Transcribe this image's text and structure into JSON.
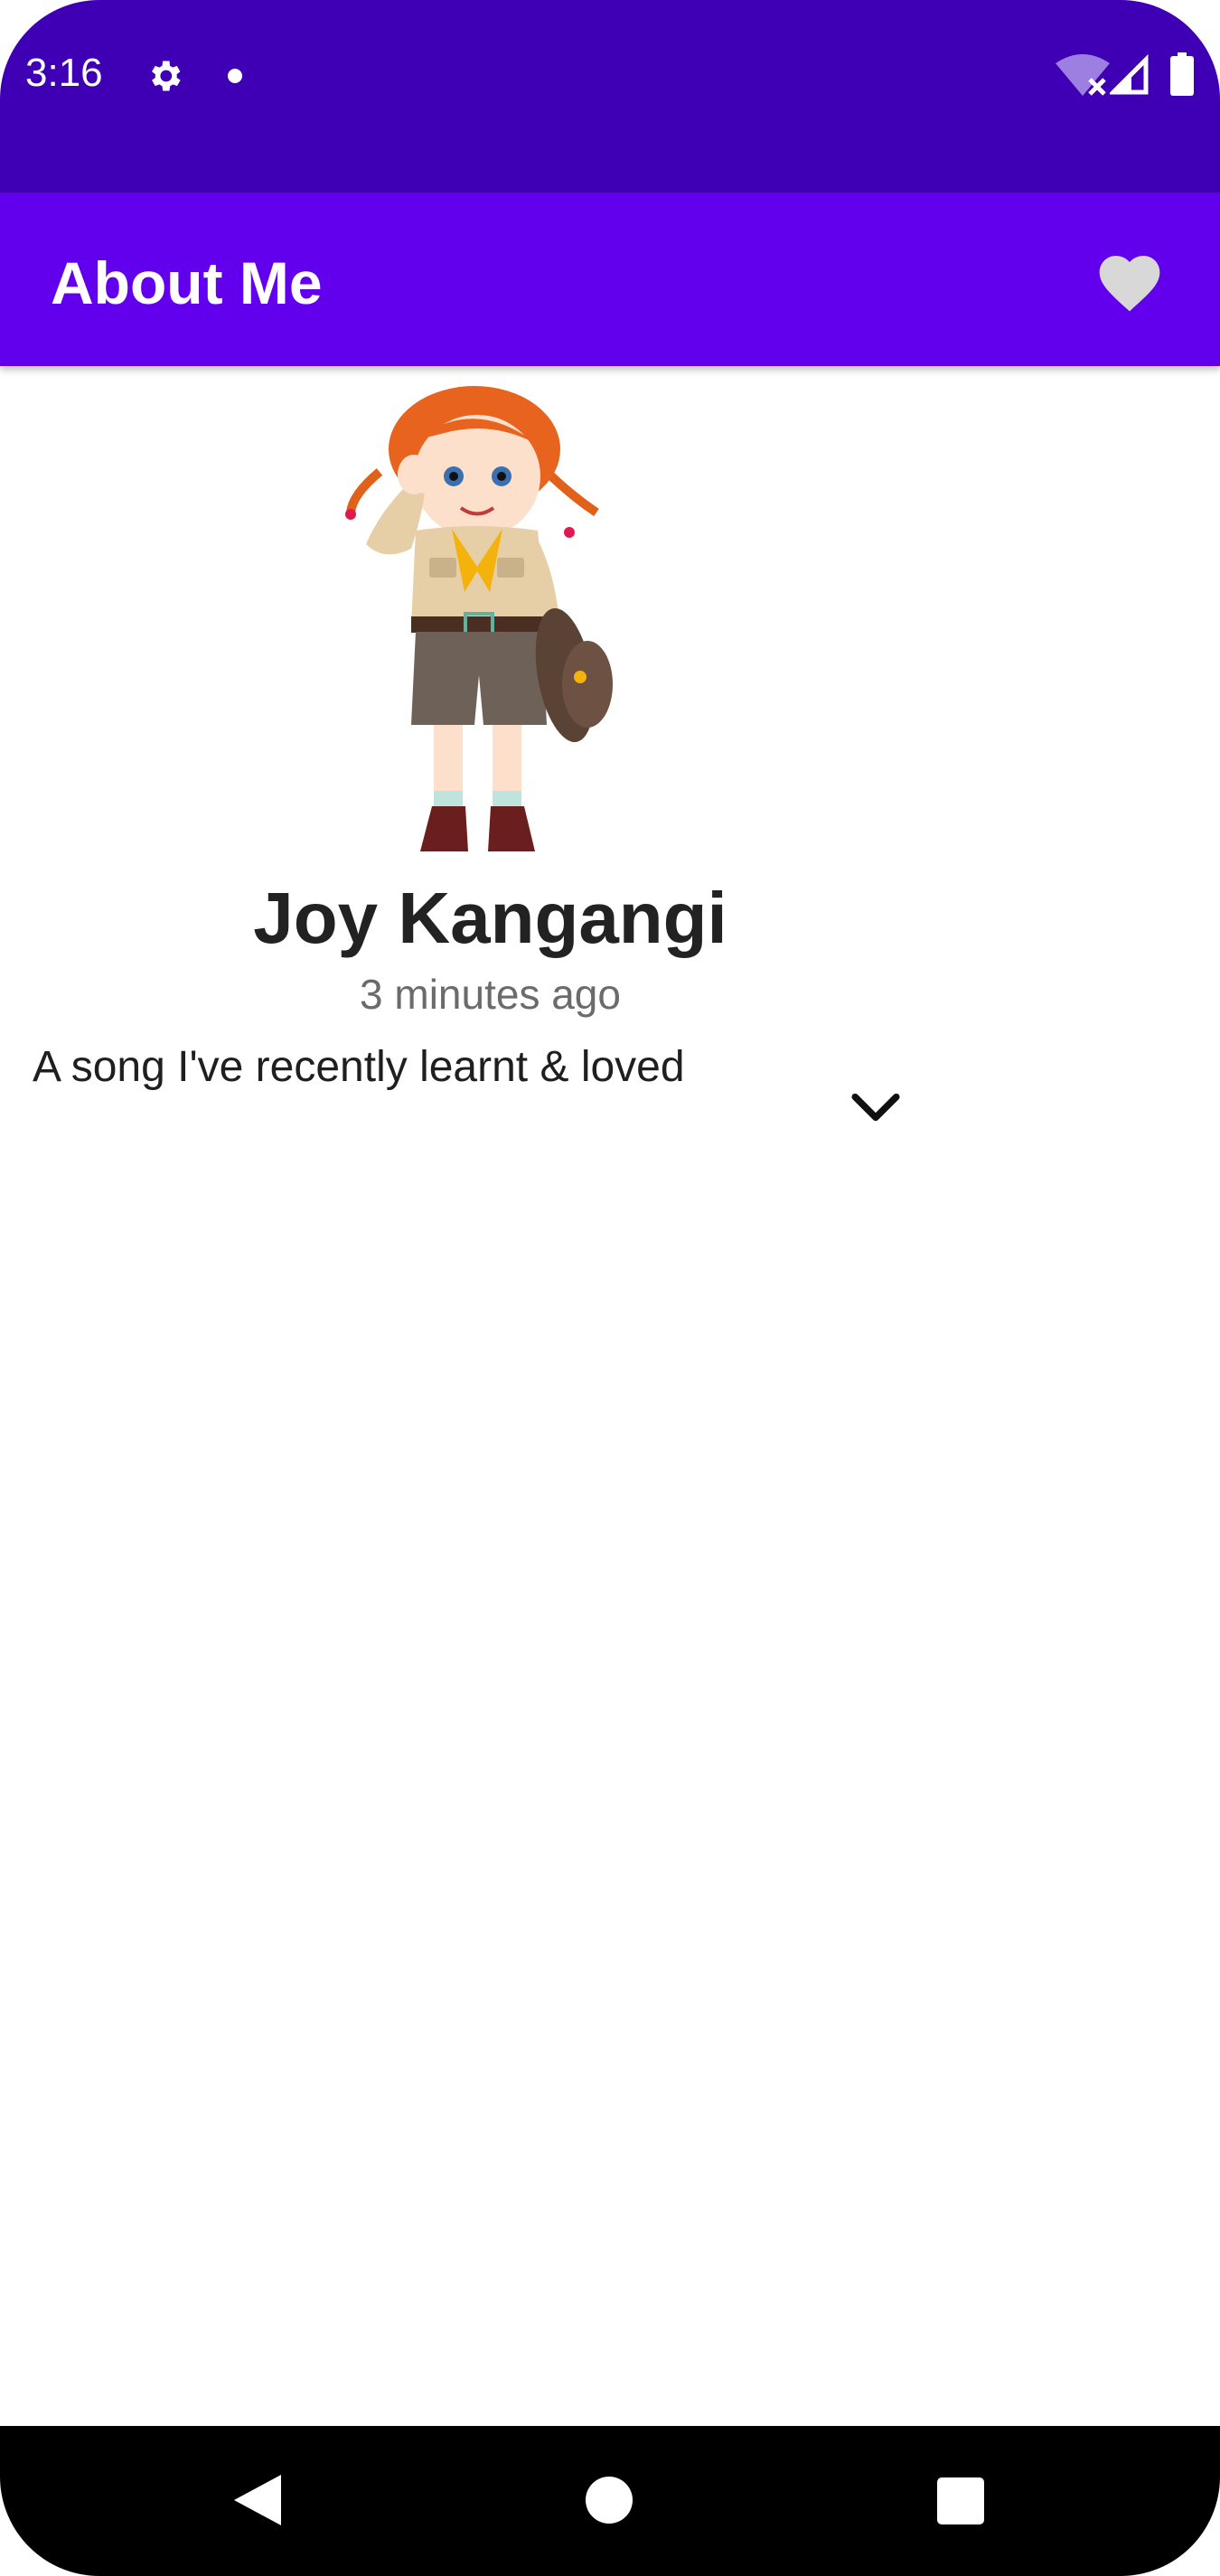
{
  "status_bar": {
    "time": "3:16",
    "icons": [
      "gear-icon",
      "notification-dot-icon",
      "wifi-off-icon",
      "cell-signal-icon",
      "battery-icon"
    ]
  },
  "app_bar": {
    "title": "About Me",
    "favorite_icon": "heart-icon"
  },
  "profile": {
    "name": "Joy Kangangi",
    "timestamp": "3 minutes ago",
    "song_label": "A song I've recently learnt & loved",
    "expand_icon": "chevron-down-icon"
  },
  "nav_bar": {
    "icons": [
      "back-icon",
      "home-icon",
      "recents-icon"
    ]
  },
  "colors": {
    "status_bar": "#3f00b5",
    "app_bar": "#6200ee",
    "heart": "#d8d8d8"
  }
}
